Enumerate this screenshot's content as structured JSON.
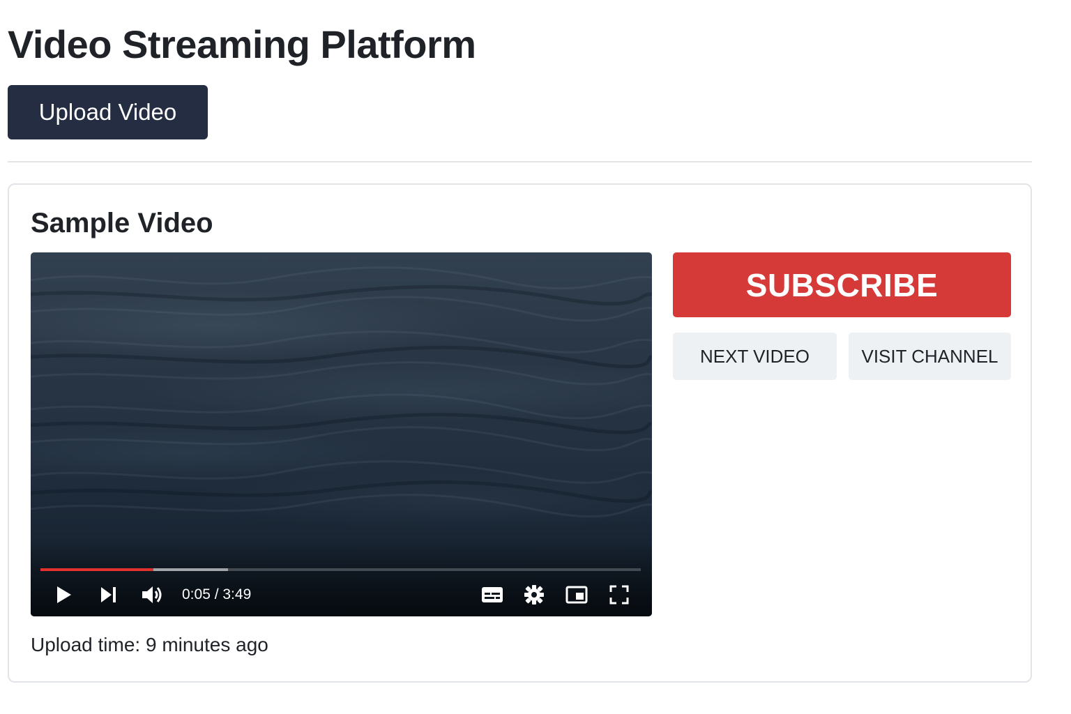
{
  "header": {
    "title": "Video Streaming Platform",
    "upload_label": "Upload Video"
  },
  "video_card": {
    "title": "Sample Video",
    "upload_time": "Upload time: 9 minutes ago"
  },
  "player": {
    "time_readout": "0:05 / 3:49",
    "played_fraction": 0.188,
    "buffered_fraction": 0.313,
    "icons": [
      "play-icon",
      "skip-next-icon",
      "volume-icon",
      "subtitles-icon",
      "settings-icon",
      "miniplayer-icon",
      "fullscreen-icon"
    ]
  },
  "actions": {
    "subscribe_label": "SUBSCRIBE",
    "next_video_label": "NEXT VIDEO",
    "visit_channel_label": "VISIT CHANNEL"
  },
  "colors": {
    "primary_button": "#252d42",
    "subscribe": "#d53a38",
    "progress_played": "#e0312f",
    "secondary_button": "#eef1f4"
  }
}
